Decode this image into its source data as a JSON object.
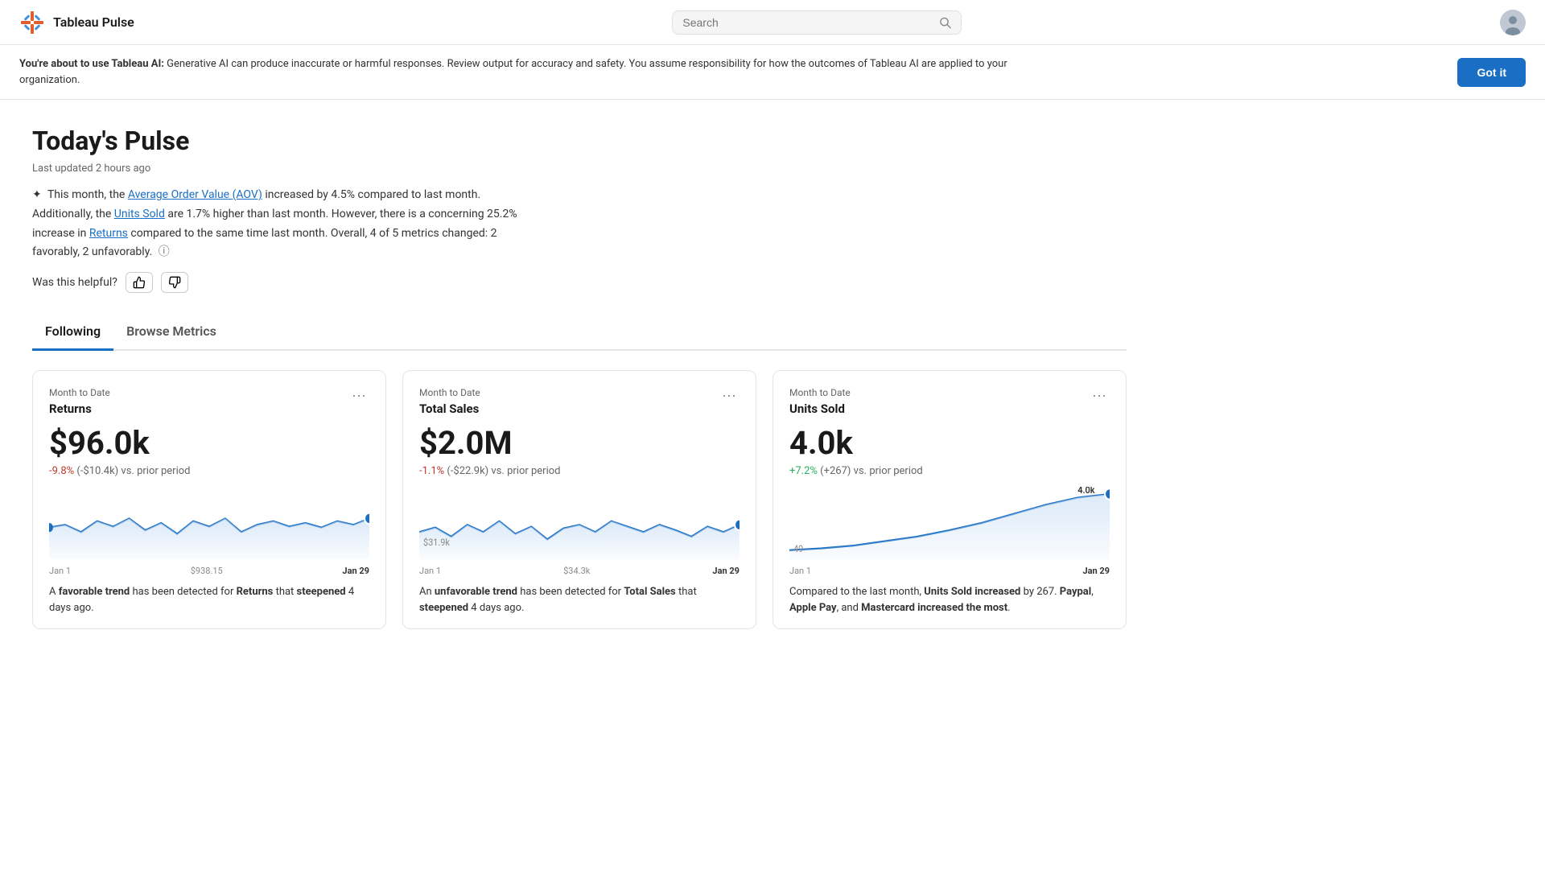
{
  "header": {
    "app_title": "Tableau Pulse",
    "search_placeholder": "Search"
  },
  "banner": {
    "text_prefix": "You're about to use ",
    "brand": "Tableau AI:",
    "text_body": " Generative AI can produce inaccurate or harmful responses. Review output for accuracy and safety. You assume responsibility for how the outcomes of Tableau AI are applied to your organization.",
    "cta_label": "Got it"
  },
  "main": {
    "page_title": "Today's Pulse",
    "last_updated": "Last updated 2 hours ago",
    "summary": "This month, the Average Order Value (AOV) increased by 4.5% compared to last month. Additionally, the Units Sold are 1.7% higher than last month. However, there is a concerning 25.2% increase in Returns compared to the same time last month. Overall, 4 of 5 metrics changed: 2 favorably, 2 unfavorably.",
    "info_icon": "ℹ",
    "feedback_label": "Was this helpful?",
    "thumbs_up": "👍",
    "thumbs_down": "👎"
  },
  "tabs": [
    {
      "id": "following",
      "label": "Following",
      "active": true
    },
    {
      "id": "browse",
      "label": "Browse Metrics",
      "active": false
    }
  ],
  "cards": [
    {
      "period": "Month to Date",
      "name": "Returns",
      "value": "$96.0k",
      "change_pct": "-9.8%",
      "change_abs": "(-$10.4k)",
      "change_suffix": " vs. prior period",
      "change_type": "neg",
      "chart_start_label": "Jan 1",
      "chart_end_label": "Jan 29",
      "chart_end_value": "$938.15",
      "chart_start_dot_value": "",
      "footer": "A <strong>favorable trend</strong> has been detected for <strong>Returns</strong> that <strong>steepened</strong> 4 days ago."
    },
    {
      "period": "Month to Date",
      "name": "Total Sales",
      "value": "$2.0M",
      "change_pct": "-1.1%",
      "change_abs": "(-$22.9k)",
      "change_suffix": " vs. prior period",
      "change_type": "neg",
      "chart_start_label": "Jan 1",
      "chart_end_label": "Jan 29",
      "chart_end_value": "$34.3k",
      "chart_start_dot_value": "$31.9k",
      "footer": "An <strong>unfavorable trend</strong> has been detected for <strong>Total Sales</strong> that <strong>steepened</strong> 4 days ago."
    },
    {
      "period": "Month to Date",
      "name": "Units Sold",
      "value": "4.0k",
      "change_pct": "+7.2%",
      "change_abs": "(+267)",
      "change_suffix": " vs. prior period",
      "change_type": "pos",
      "chart_start_label": "Jan 1",
      "chart_end_label": "Jan 29",
      "chart_end_value": "4.0k",
      "chart_start_dot_value": "49",
      "footer": "Compared to the last month, <strong>Units Sold increased</strong> by 267. <strong>Paypal</strong>, <strong>Apple Pay</strong>, and <strong>Mastercard increased the most</strong>."
    }
  ]
}
